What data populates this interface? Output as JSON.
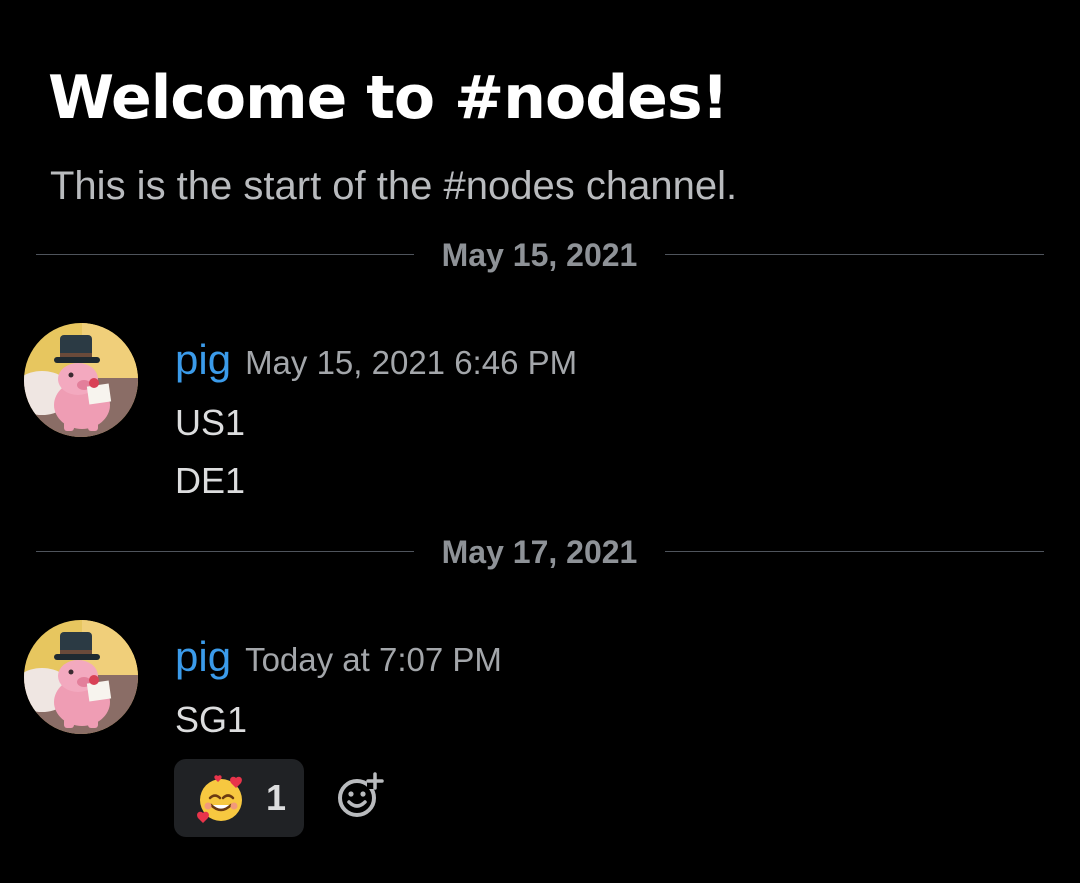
{
  "channel": {
    "welcome_title": "Welcome to #nodes!",
    "welcome_subtitle": "This is the start of the #nodes channel."
  },
  "dividers": [
    {
      "date": "May 15, 2021"
    },
    {
      "date": "May 17, 2021"
    }
  ],
  "messages": [
    {
      "author": "pig",
      "timestamp": "May 15, 2021 6:46 PM",
      "lines": [
        "US1",
        "DE1"
      ],
      "avatar_icon": "pig-avatar"
    },
    {
      "author": "pig",
      "timestamp": "Today at 7:07 PM",
      "lines": [
        "SG1"
      ],
      "avatar_icon": "pig-avatar",
      "reactions": [
        {
          "emoji_icon": "smiling-face-with-hearts-emoji",
          "count": "1"
        }
      ]
    }
  ],
  "colors": {
    "background": "#000000",
    "author": "#3b9bea",
    "timestamp": "#a3a6aa",
    "message_text": "#dcddde",
    "divider": "#4f545c",
    "reaction_bg": "#202225"
  },
  "icons": {
    "add_reaction": "add-reaction-icon"
  }
}
